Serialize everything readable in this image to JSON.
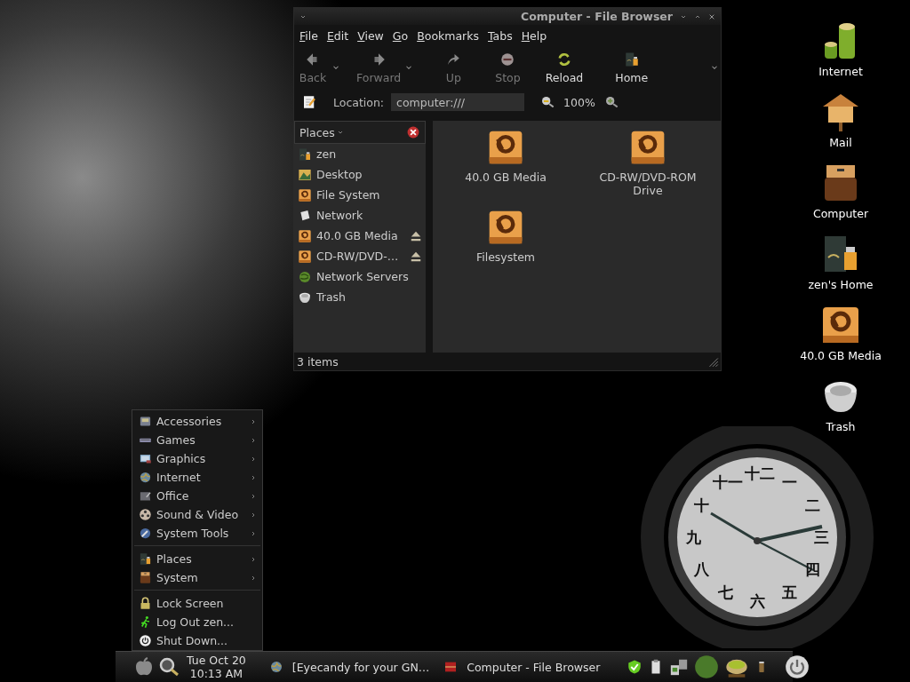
{
  "file_browser": {
    "title": "Computer - File Browser",
    "menu": [
      "File",
      "Edit",
      "View",
      "Go",
      "Bookmarks",
      "Tabs",
      "Help"
    ],
    "toolbar": [
      {
        "label": "Back",
        "kind": "back",
        "disabled": true,
        "dropdown": true
      },
      {
        "label": "Forward",
        "kind": "forward",
        "disabled": true,
        "dropdown": true
      },
      {
        "label": "Up",
        "kind": "up",
        "disabled": true,
        "dropdown": false
      },
      {
        "label": "Stop",
        "kind": "stop",
        "disabled": true,
        "dropdown": false
      },
      {
        "label": "Reload",
        "kind": "reload",
        "disabled": false,
        "dropdown": false
      },
      {
        "label": "Home",
        "kind": "home",
        "disabled": false,
        "dropdown": false
      }
    ],
    "location": {
      "label": "Location:",
      "value": "computer:///"
    },
    "zoom": "100%",
    "sidebar": {
      "title": "Places",
      "items": [
        {
          "label": "zen",
          "kind": "home",
          "eject": false
        },
        {
          "label": "Desktop",
          "kind": "desktop",
          "eject": false
        },
        {
          "label": "File System",
          "kind": "drive",
          "eject": false
        },
        {
          "label": "Network",
          "kind": "network",
          "eject": false
        },
        {
          "label": "40.0 GB Media",
          "kind": "drive",
          "eject": true
        },
        {
          "label": "CD-RW/DVD-…",
          "kind": "drive",
          "eject": true
        },
        {
          "label": "Network Servers",
          "kind": "servers",
          "eject": false
        },
        {
          "label": "Trash",
          "kind": "trash",
          "eject": false
        }
      ]
    },
    "items": [
      {
        "label": "40.0 GB Media",
        "kind": "drive"
      },
      {
        "label": "CD-RW/DVD-ROM Drive",
        "kind": "drive"
      },
      {
        "label": "Filesystem",
        "kind": "drive"
      }
    ],
    "status": "3 items"
  },
  "desktop_icons": [
    {
      "label": "Internet",
      "kind": "internet"
    },
    {
      "label": "Mail",
      "kind": "mail"
    },
    {
      "label": "Computer",
      "kind": "computer"
    },
    {
      "label": "zen's Home",
      "kind": "home"
    },
    {
      "label": "40.0 GB Media",
      "kind": "drive"
    },
    {
      "label": "Trash",
      "kind": "trash"
    }
  ],
  "app_menu": {
    "groups": [
      [
        {
          "label": "Accessories",
          "kind": "accessories",
          "submenu": true
        },
        {
          "label": "Games",
          "kind": "games",
          "submenu": true
        },
        {
          "label": "Graphics",
          "kind": "graphics",
          "submenu": true
        },
        {
          "label": "Internet",
          "kind": "globe",
          "submenu": true
        },
        {
          "label": "Office",
          "kind": "office",
          "submenu": true
        },
        {
          "label": "Sound & Video",
          "kind": "sound",
          "submenu": true
        },
        {
          "label": "System Tools",
          "kind": "tools",
          "submenu": true
        }
      ],
      [
        {
          "label": "Places",
          "kind": "home",
          "submenu": true
        },
        {
          "label": "System",
          "kind": "computer",
          "submenu": true
        }
      ],
      [
        {
          "label": "Lock Screen",
          "kind": "lock",
          "submenu": false
        },
        {
          "label": "Log Out zen...",
          "kind": "logout",
          "submenu": false
        },
        {
          "label": "Shut Down...",
          "kind": "power",
          "submenu": false
        }
      ]
    ]
  },
  "clock": {
    "numerals": [
      "十一",
      "十二",
      "一",
      "二",
      "三",
      "四",
      "五",
      "六",
      "七",
      "八",
      "九",
      "十"
    ]
  },
  "taskbar": {
    "date": "Tue Oct 20",
    "time": "10:13 AM",
    "tasks": [
      {
        "label": "[Eyecandy for your GN…",
        "kind": "globe"
      },
      {
        "label": "Computer - File Browser",
        "kind": "drawer"
      }
    ]
  }
}
